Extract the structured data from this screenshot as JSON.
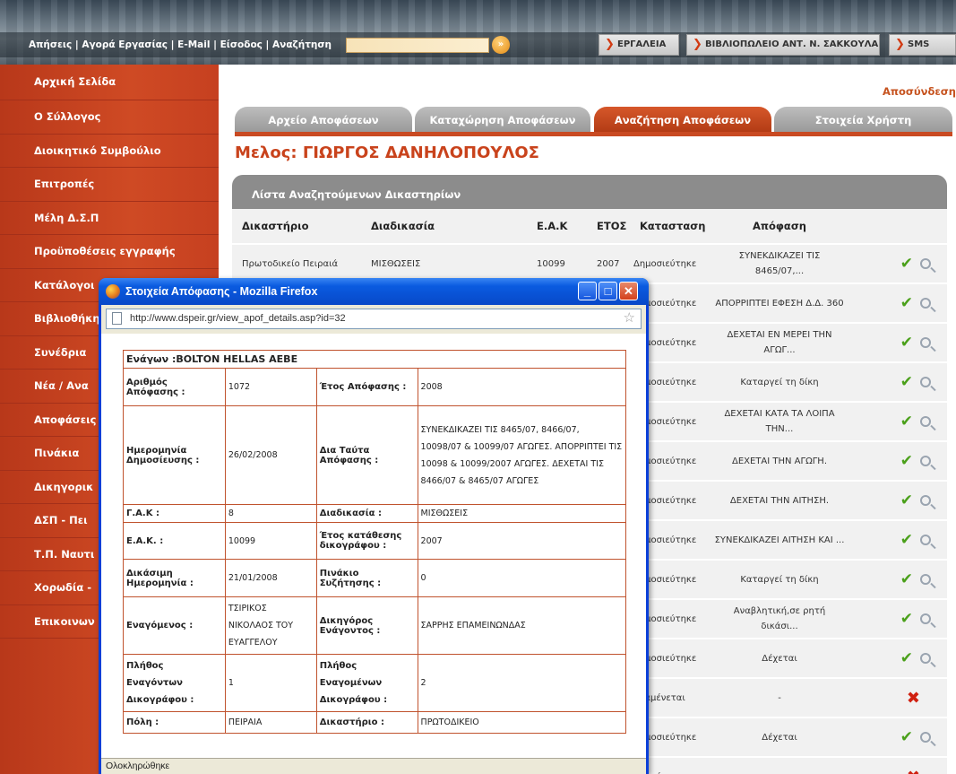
{
  "header": {
    "top_links": "Απήσεις | Αγορά Εργασίας | E-Mail | Είσοδος | Αναζήτηση",
    "search_go": "»",
    "buttons": {
      "tools": "ΕΡΓΑΛΕΙΑ",
      "library": "ΒΙΒΛΙΟΠΩΛΕΙΟ ΑΝΤ. Ν. ΣΑΚΚΟΥΛΑ",
      "sms": "SMS"
    }
  },
  "sidebar": {
    "items": [
      {
        "label": "Αρχική Σελίδα"
      },
      {
        "label": "Ο Σύλλογος"
      },
      {
        "label": "Διοικητικό Συμβούλιο"
      },
      {
        "label": "Επιτροπές"
      },
      {
        "label": "Μέλη Δ.Σ.Π"
      },
      {
        "label": "Προϋποθέσεις εγγραφής"
      },
      {
        "label": "Κατάλογοι"
      },
      {
        "label": "Βιβλιοθήκη"
      },
      {
        "label": "Συνέδρια"
      },
      {
        "label": "Νέα / Ανα"
      },
      {
        "label": "Αποφάσεις"
      },
      {
        "label": "Πινάκια"
      },
      {
        "label": "Δικηγορικ"
      },
      {
        "label": "ΔΣΠ - Πει"
      },
      {
        "label": "Τ.Π. Ναυτι"
      },
      {
        "label": "Χορωδία -"
      },
      {
        "label": "Επικοινων"
      }
    ]
  },
  "main": {
    "logout": "Αποσύνδεση",
    "tabs": [
      {
        "label": "Αρχείο Αποφάσεων"
      },
      {
        "label": "Καταχώρηση Αποφάσεων"
      },
      {
        "label": "Αναζήτηση Αποφάσεων"
      },
      {
        "label": "Στοιχεία Χρήστη"
      }
    ],
    "member_title": "Μελος: ΓΙΩΡΓΟΣ ΔΑΝΗΛΟΠΟΥΛΟΣ",
    "list_title": "Λίστα Αναζητούμενων Δικαστηρίων",
    "columns": [
      "Δικαστήριο",
      "Διαδικασία",
      "Ε.Α.Κ",
      "ΕΤΟΣ",
      "Κατασταση",
      "Απόφαση"
    ],
    "rows": [
      {
        "court": "Πρωτοδικείο Πειραιά",
        "proc": "ΜΙΣΘΩΣΕΙΣ",
        "eak": "10099",
        "year": "2007",
        "status": "Δημοσιεύτηκε",
        "decision": "ΣΥΝΕΚΔΙΚΑΖΕΙ ΤΙΣ 8465/07,...",
        "ok": true
      },
      {
        "court": "",
        "proc": "",
        "eak": "",
        "year": "",
        "status": "Δημοσιεύτηκε",
        "decision": "ΑΠΟΡΡΙΠΤΕΙ ΕΦΕΣΗ Δ.Δ. 360",
        "ok": true
      },
      {
        "court": "",
        "proc": "",
        "eak": "",
        "year": "",
        "status": "Δημοσιεύτηκε",
        "decision": "ΔΕΧΕΤΑΙ ΕΝ ΜΕΡΕΙ ΤΗΝ ΑΓΩΓ...",
        "ok": true
      },
      {
        "court": "",
        "proc": "",
        "eak": "",
        "year": "",
        "status": "Δημοσιεύτηκε",
        "decision": "Καταργεί τη δίκη",
        "ok": true
      },
      {
        "court": "",
        "proc": "",
        "eak": "",
        "year": "",
        "status": "Δημοσιεύτηκε",
        "decision": "ΔΕΧΕΤΑΙ ΚΑΤΑ ΤΑ ΛΟΙΠΑ ΤΗΝ...",
        "ok": true
      },
      {
        "court": "",
        "proc": "",
        "eak": "",
        "year": "",
        "status": "Δημοσιεύτηκε",
        "decision": "ΔΕΧΕΤΑΙ ΤΗΝ ΑΓΩΓΗ.",
        "ok": true
      },
      {
        "court": "",
        "proc": "",
        "eak": "",
        "year": "",
        "status": "Δημοσιεύτηκε",
        "decision": "ΔΕΧΕΤΑΙ ΤΗΝ ΑΙΤΗΣΗ.",
        "ok": true
      },
      {
        "court": "",
        "proc": "",
        "eak": "",
        "year": "",
        "status": "Δημοσιεύτηκε",
        "decision": "ΣΥΝΕΚΔΙΚΑΖΕΙ ΑΙΤΗΣΗ ΚΑΙ ...",
        "ok": true
      },
      {
        "court": "",
        "proc": "",
        "eak": "",
        "year": "",
        "status": "Δημοσιεύτηκε",
        "decision": "Καταργεί τη δίκη",
        "ok": true
      },
      {
        "court": "",
        "proc": "",
        "eak": "",
        "year": "",
        "status": "Δημοσιεύτηκε",
        "decision": "Αναβλητική,σε ρητή δικάσι...",
        "ok": true
      },
      {
        "court": "",
        "proc": "",
        "eak": "",
        "year": "",
        "status": "Δημοσιεύτηκε",
        "decision": "Δέχεται",
        "ok": true
      },
      {
        "court": "",
        "proc": "",
        "eak": "",
        "year": "",
        "status": "Αναμένεται",
        "decision": "-",
        "ok": false
      },
      {
        "court": "",
        "proc": "",
        "eak": "",
        "year": "",
        "status": "Δημοσιεύτηκε",
        "decision": "Δέχεται",
        "ok": true
      },
      {
        "court": "",
        "proc": "",
        "eak": "",
        "year": "",
        "status": "Αναμένεται",
        "decision": "-",
        "ok": false
      }
    ]
  },
  "popup": {
    "title": "Στοιχεία Απόφασης - Mozilla Firefox",
    "url": "http://www.dspeir.gr/view_apof_details.asp?id=32",
    "status": "Ολοκληρώθηκε",
    "min": "_",
    "max": "□",
    "close": "✕",
    "details": {
      "header": "Ενάγων :BOLTON HELLAS ΑΕΒΕ",
      "decision_no_label": "Αριθμός Απόφασης :",
      "decision_no": "1072",
      "decision_year_label": "Έτος Απόφασης :",
      "decision_year": "2008",
      "pub_date_label": "Ημερομηνία Δημοσίευσης :",
      "pub_date": "26/02/2008",
      "ruling_label": "Δια Ταύτα Απόφασης :",
      "ruling": "ΣΥΝΕΚΔΙΚΑΖΕΙ ΤΙΣ 8465/07, 8466/07, 10098/07 & 10099/07 ΑΓΩΓΕΣ. ΑΠΟΡΡΙΠΤΕΙ ΤΙΣ 10098 & 10099/2007 ΑΓΩΓΕΣ. ΔΕΧΕΤΑΙ ΤΙΣ 8466/07 & 8465/07 ΑΓΩΓΕΣ",
      "gak_label": "Γ.Α.Κ :",
      "gak": "8",
      "proc_label": "Διαδικασία :",
      "proc": "ΜΙΣΘΩΣΕΙΣ",
      "eak_label": "Ε.Α.Κ. :",
      "eak": "10099",
      "filing_year_label": "Έτος κατάθεσης δικογράφου :",
      "filing_year": "2007",
      "hearing_label": "Δικάσιμη Ημερομηνία :",
      "hearing": "21/01/2008",
      "docket_label": "Πινάκιο Συζήτησης :",
      "docket": "0",
      "defendant_label": "Εναγόμενος :",
      "defendant": "ΤΣΙΡΙΚΟΣ ΝΙΚΟΛΑΟΣ ΤΟΥ ΕΥΑΓΓΕΛΟΥ",
      "lawyer_label": "Δικηγόρος Ενάγοντος :",
      "lawyer": "ΣΑΡΡΗΣ ΕΠΑΜΕΙΝΩΝΔΑΣ",
      "plaintiffs_label": "Πλήθος Εναγόντων Δικογράφου :",
      "plaintiffs": "1",
      "defendants_label": "Πλήθος Εναγομένων Δικογράφου :",
      "defendants": "2",
      "city_label": "Πόλη :",
      "city": "ΠΕΙΡΑΙΑ",
      "court_label": "Δικαστήριο :",
      "court": "ΠΡΩΤΟΔΙΚΕΙΟ"
    }
  }
}
